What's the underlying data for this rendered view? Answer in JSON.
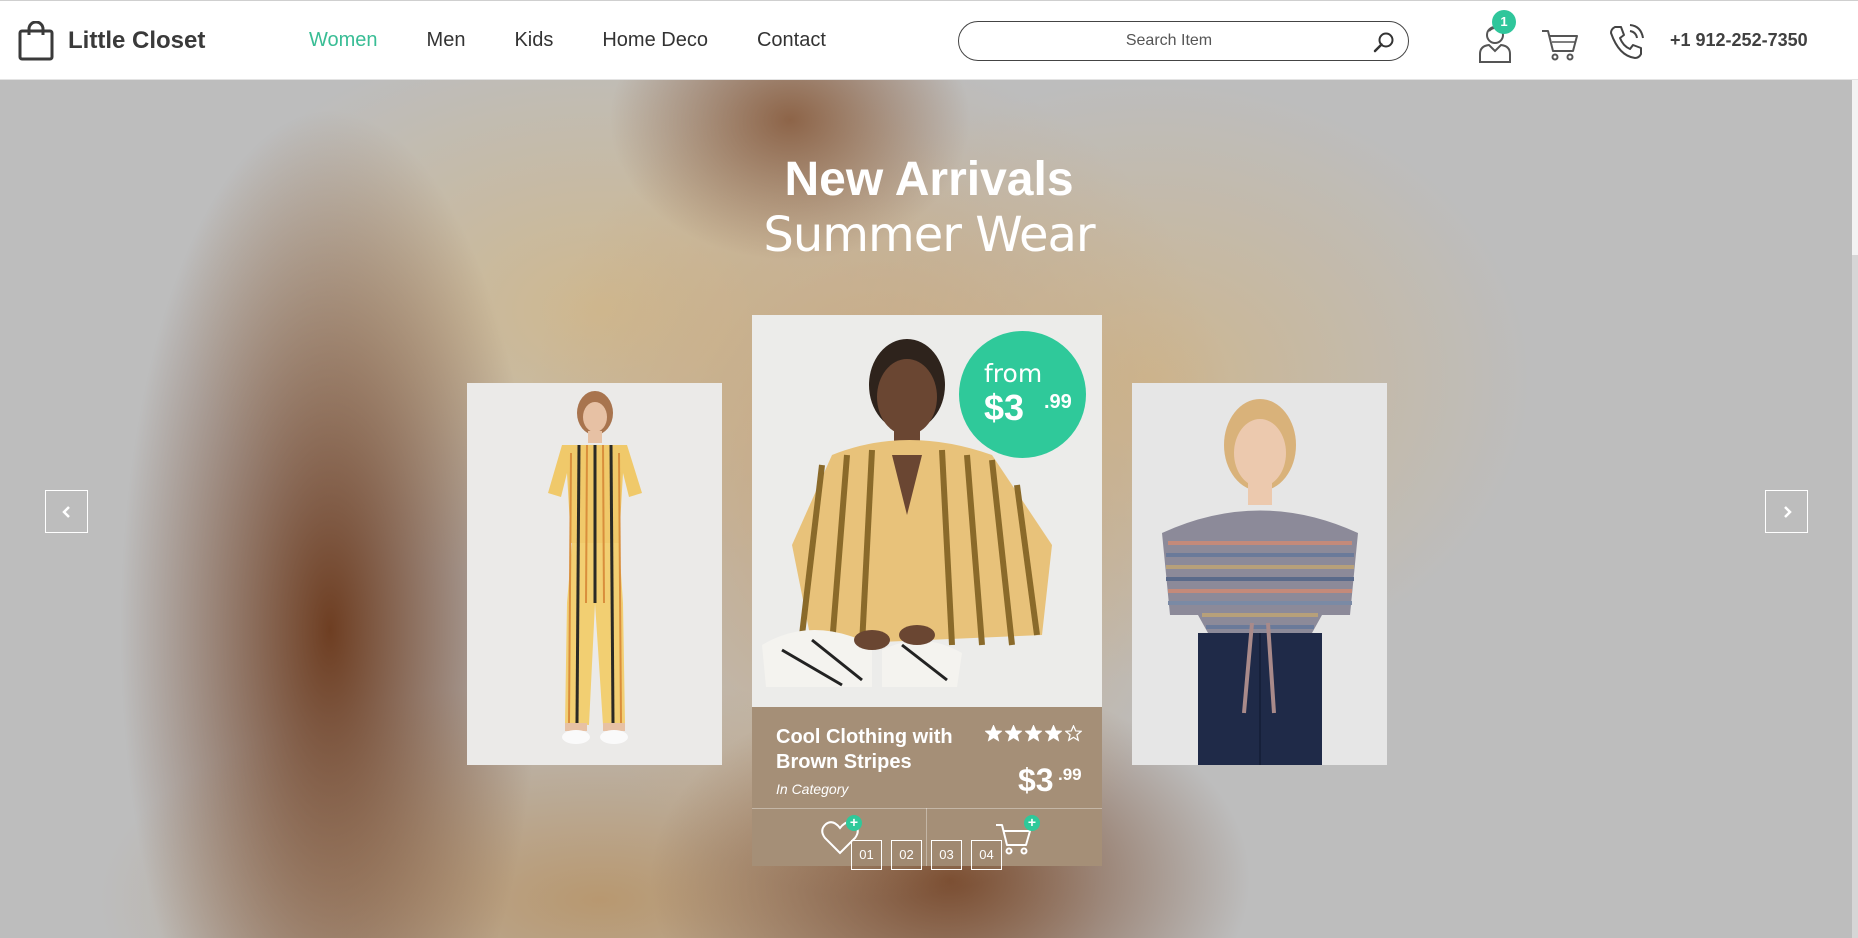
{
  "brand": {
    "name": "Little Closet"
  },
  "nav": {
    "items": [
      {
        "label": "Women",
        "active": true
      },
      {
        "label": "Men",
        "active": false
      },
      {
        "label": "Kids",
        "active": false
      },
      {
        "label": "Home Deco",
        "active": false
      },
      {
        "label": "Contact",
        "active": false
      }
    ]
  },
  "search": {
    "placeholder": "Search Item",
    "value": ""
  },
  "header": {
    "user_badge": "1",
    "phone": "+1 912-252-7350",
    "icons": [
      "user-icon",
      "cart-icon",
      "phone-icon"
    ]
  },
  "hero": {
    "title": "New Arrivals",
    "subtitle": "Summer Wear",
    "badge_from": "from",
    "badge_price": "$3",
    "badge_cents": ".99"
  },
  "product": {
    "name": "Cool Clothing with Brown Stripes",
    "category": "In Category",
    "price": "$3",
    "cents": ".99",
    "rating": 4,
    "rating_max": 5
  },
  "pager": [
    "01",
    "02",
    "03",
    "04"
  ],
  "colors": {
    "accent": "#2fc99a",
    "active_nav": "#39bd95",
    "text_dark": "#333333"
  }
}
